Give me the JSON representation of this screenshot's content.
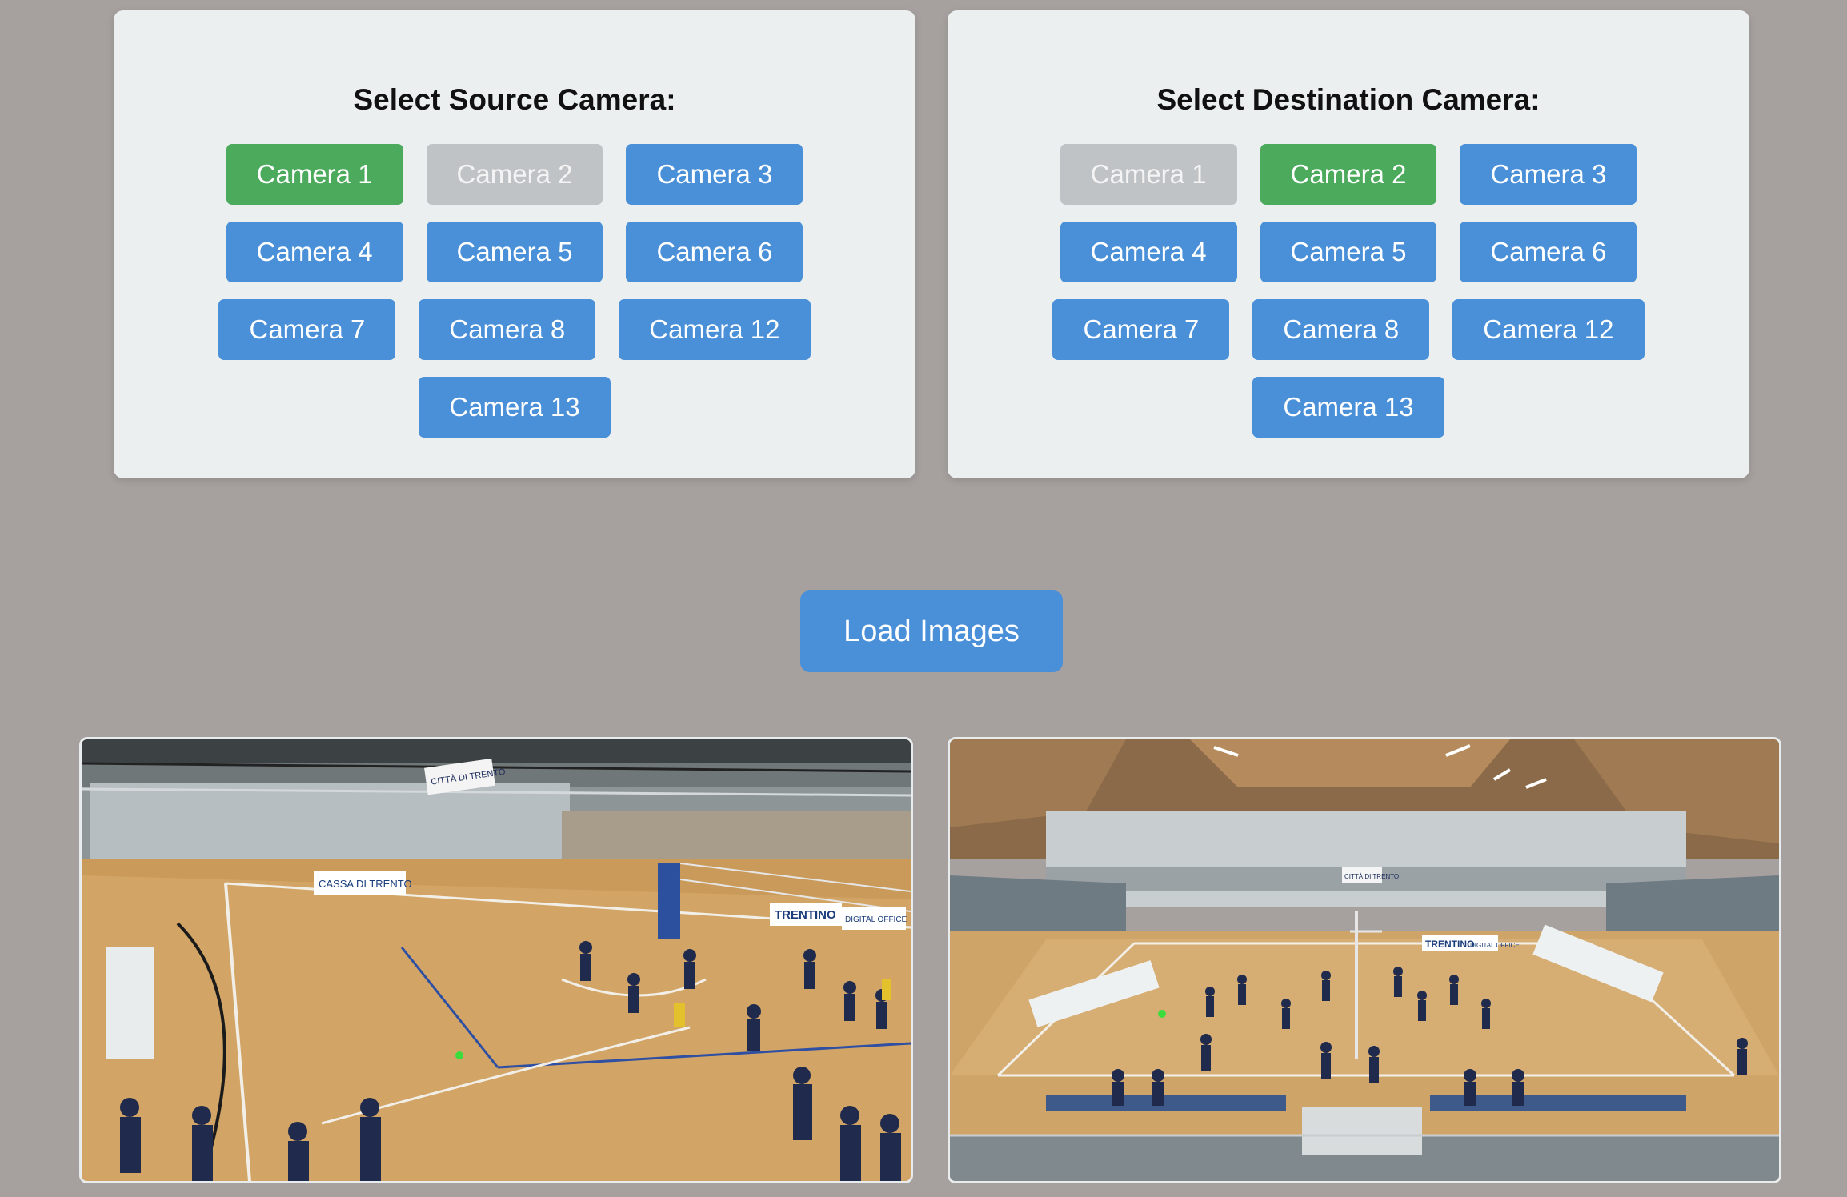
{
  "source": {
    "title": "Select Source Camera:",
    "cameras": [
      {
        "label": "Camera 1",
        "state": "selected"
      },
      {
        "label": "Camera 2",
        "state": "disabled"
      },
      {
        "label": "Camera 3",
        "state": "normal"
      },
      {
        "label": "Camera 4",
        "state": "normal"
      },
      {
        "label": "Camera 5",
        "state": "normal"
      },
      {
        "label": "Camera 6",
        "state": "normal"
      },
      {
        "label": "Camera 7",
        "state": "normal"
      },
      {
        "label": "Camera 8",
        "state": "normal"
      },
      {
        "label": "Camera 12",
        "state": "normal"
      },
      {
        "label": "Camera 13",
        "state": "normal"
      }
    ]
  },
  "destination": {
    "title": "Select Destination Camera:",
    "cameras": [
      {
        "label": "Camera 1",
        "state": "disabled"
      },
      {
        "label": "Camera 2",
        "state": "selected"
      },
      {
        "label": "Camera 3",
        "state": "normal"
      },
      {
        "label": "Camera 4",
        "state": "normal"
      },
      {
        "label": "Camera 5",
        "state": "normal"
      },
      {
        "label": "Camera 6",
        "state": "normal"
      },
      {
        "label": "Camera 7",
        "state": "normal"
      },
      {
        "label": "Camera 8",
        "state": "normal"
      },
      {
        "label": "Camera 12",
        "state": "normal"
      },
      {
        "label": "Camera 13",
        "state": "normal"
      }
    ]
  },
  "load_button_label": "Load Images",
  "colors": {
    "background": "#a6a19f",
    "panel": "#ecefef",
    "button_blue": "#4a90d9",
    "button_selected": "#4caa5d",
    "button_disabled": "#bfc3c6",
    "marker_green": "#3ddc3d"
  },
  "source_image": {
    "banner_texts": [
      "CITTÀ DI TRENTO",
      "CASSA DI TRENTO",
      "TRENTINO",
      "DIGITAL OFFICE"
    ]
  },
  "destination_image": {
    "banner_texts": [
      "CITTÀ DI TRENTO",
      "TRENTINO",
      "DIGITAL OFFICE"
    ]
  }
}
